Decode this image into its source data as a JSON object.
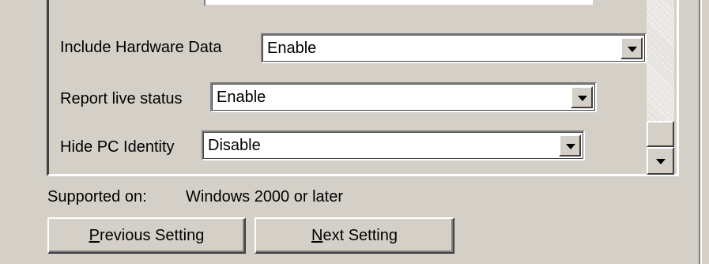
{
  "settings": [
    {
      "label": "Include Hardware Data",
      "value": "Enable"
    },
    {
      "label": "Report live status",
      "value": "Enable"
    },
    {
      "label": "Hide PC Identity",
      "value": "Disable"
    }
  ],
  "supported": {
    "label": "Supported on:",
    "value": "Windows 2000 or later"
  },
  "buttons": {
    "previous": {
      "accesskey": "P",
      "rest": "revious Setting"
    },
    "next": {
      "accesskey": "N",
      "rest": "ext Setting"
    }
  },
  "icons": {
    "dropdown": "chevron-down-icon",
    "scroll_down": "scroll-down-arrow-icon"
  },
  "colors": {
    "dialog_bg": "#d4d0c8",
    "field_bg": "#ffffff"
  }
}
